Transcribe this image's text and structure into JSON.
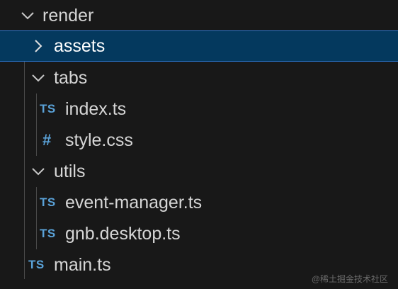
{
  "tree": {
    "root": {
      "label": "render",
      "icon": "chevron-down-icon"
    },
    "assets": {
      "label": "assets",
      "icon": "chevron-right-icon"
    },
    "tabs": {
      "label": "tabs",
      "icon": "chevron-down-icon"
    },
    "tabs_index": {
      "badge": "TS",
      "label": "index.ts"
    },
    "tabs_style": {
      "badge": "#",
      "label": "style.css"
    },
    "utils": {
      "label": "utils",
      "icon": "chevron-down-icon"
    },
    "utils_event": {
      "badge": "TS",
      "label": "event-manager.ts"
    },
    "utils_gnb": {
      "badge": "TS",
      "label": "gnb.desktop.ts"
    },
    "main": {
      "badge": "TS",
      "label": "main.ts"
    }
  },
  "watermark": "@稀土掘金技术社区",
  "colors": {
    "background": "#181818",
    "selected_background": "#04395e",
    "selected_border": "#2b7ad6",
    "ts_icon": "#5aa2d8"
  }
}
